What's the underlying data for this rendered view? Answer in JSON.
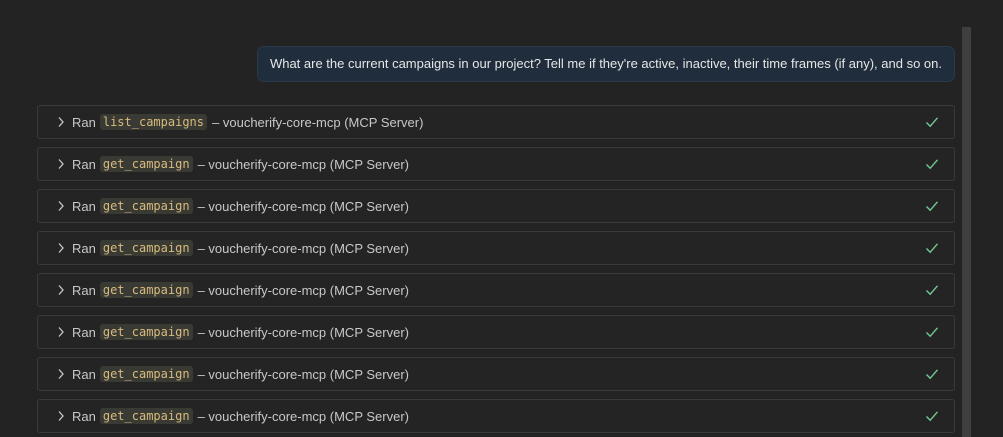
{
  "user_message": "What are the current campaigns in our project? Tell me if they're active, inactive, their time frames (if any), and so on.",
  "tool_calls": [
    {
      "verb": "Ran",
      "tool": "list_campaigns",
      "suffix": "– voucherify-core-mcp (MCP Server)",
      "status": "success"
    },
    {
      "verb": "Ran",
      "tool": "get_campaign",
      "suffix": "– voucherify-core-mcp (MCP Server)",
      "status": "success"
    },
    {
      "verb": "Ran",
      "tool": "get_campaign",
      "suffix": "– voucherify-core-mcp (MCP Server)",
      "status": "success"
    },
    {
      "verb": "Ran",
      "tool": "get_campaign",
      "suffix": "– voucherify-core-mcp (MCP Server)",
      "status": "success"
    },
    {
      "verb": "Ran",
      "tool": "get_campaign",
      "suffix": "– voucherify-core-mcp (MCP Server)",
      "status": "success"
    },
    {
      "verb": "Ran",
      "tool": "get_campaign",
      "suffix": "– voucherify-core-mcp (MCP Server)",
      "status": "success"
    },
    {
      "verb": "Ran",
      "tool": "get_campaign",
      "suffix": "– voucherify-core-mcp (MCP Server)",
      "status": "success"
    },
    {
      "verb": "Ran",
      "tool": "get_campaign",
      "suffix": "– voucherify-core-mcp (MCP Server)",
      "status": "success"
    }
  ],
  "icons": {
    "expand": "chevron-right-icon",
    "status": "checkmark-icon"
  },
  "colors": {
    "background": "#232323",
    "bubble": "#1f2d3c",
    "tool_name": "#d7ba7d",
    "check": "#73c991"
  }
}
